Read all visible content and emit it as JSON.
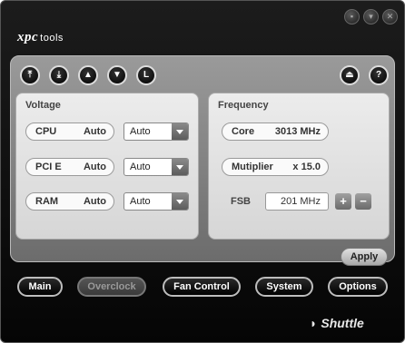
{
  "window": {
    "logo_prefix": "xpc",
    "logo_suffix": "tools",
    "brand": "Shuttle",
    "controls": [
      "minimize-icon",
      "restore-icon",
      "close-icon"
    ]
  },
  "toolbar": {
    "icons": [
      "top-icon",
      "bottom-icon",
      "up-icon",
      "down-icon",
      "l-icon",
      "eject-icon",
      "help-icon"
    ],
    "l_label": "L",
    "help_label": "?"
  },
  "voltage": {
    "title": "Voltage",
    "rows": [
      {
        "label": "CPU",
        "value": "Auto",
        "select": "Auto"
      },
      {
        "label": "PCI E",
        "value": "Auto",
        "select": "Auto"
      },
      {
        "label": "RAM",
        "value": "Auto",
        "select": "Auto"
      }
    ]
  },
  "frequency": {
    "title": "Frequency",
    "core_label": "Core",
    "core_value": "3013 MHz",
    "multiplier_label": "Mutiplier",
    "multiplier_value": "x 15.0",
    "fsb_label": "FSB",
    "fsb_value": "201 MHz",
    "plus": "+",
    "minus": "−"
  },
  "apply_label": "Apply",
  "nav": {
    "main": "Main",
    "overclock": "Overclock",
    "fan_control": "Fan Control",
    "system": "System",
    "options": "Options",
    "active": "Overclock"
  }
}
